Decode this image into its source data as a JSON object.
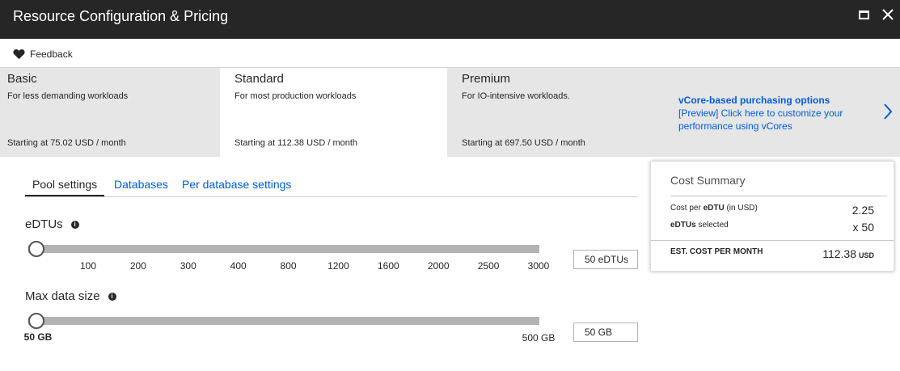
{
  "window": {
    "title": "Resource Configuration & Pricing"
  },
  "toolbar": {
    "feedback_label": "Feedback"
  },
  "tiers": [
    {
      "name": "Basic",
      "description": "For less demanding workloads",
      "price": "Starting at 75.02 USD / month",
      "selected": false
    },
    {
      "name": "Standard",
      "description": "For most production workloads",
      "price": "Starting at 112.38 USD / month",
      "selected": true
    },
    {
      "name": "Premium",
      "description": "For IO-intensive workloads.",
      "price": "Starting at 697.50 USD / month",
      "selected": false
    }
  ],
  "vcore": {
    "title": "vCore-based purchasing options",
    "description": "[Preview] Click here to customize your performance using vCores"
  },
  "tabs": [
    {
      "label": "Pool settings",
      "active": true
    },
    {
      "label": "Databases",
      "active": false
    },
    {
      "label": "Per database settings",
      "active": false
    }
  ],
  "edtus": {
    "label": "eDTUs",
    "ticks": [
      "100",
      "200",
      "300",
      "400",
      "800",
      "1200",
      "1600",
      "2000",
      "2500",
      "3000"
    ],
    "value": "50 eDTUs",
    "slider_fraction": 0
  },
  "max_data_size": {
    "label": "Max data size",
    "min_label": "50 GB",
    "max_label": "500 GB",
    "value": "50 GB",
    "slider_fraction": 0
  },
  "cost_summary": {
    "title": "Cost Summary",
    "row1_prefix": "Cost per ",
    "row1_bold": "eDTU",
    "row1_suffix": " (in USD)",
    "row1_value": "2.25",
    "row2_bold": "eDTUs",
    "row2_suffix": " selected",
    "row2_value": "x 50",
    "total_label": "EST. COST PER MONTH",
    "total_value": "112.38",
    "total_unit": "USD"
  },
  "colors": {
    "titlebar": "#262626",
    "link": "#015cda",
    "tier_background": "#e6e6e6",
    "slider_track": "#b3b3b3"
  }
}
